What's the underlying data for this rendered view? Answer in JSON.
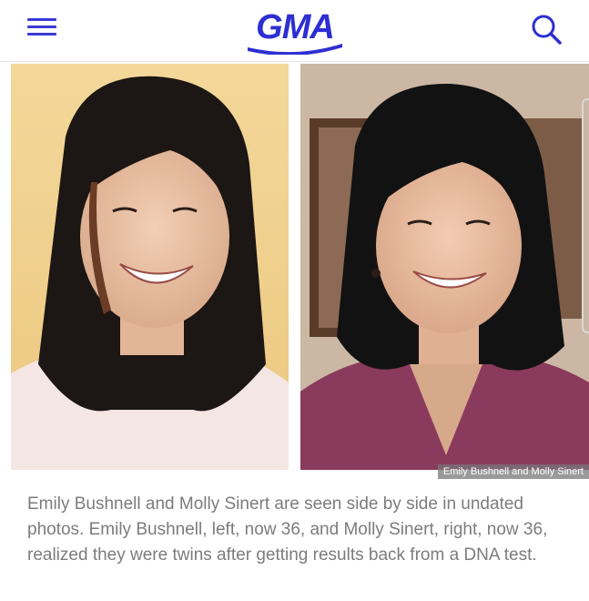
{
  "header": {
    "menu_icon": "hamburger-menu-icon",
    "logo_text": "GMA",
    "search_icon": "search-icon",
    "accent_color": "#2d2fd3"
  },
  "photos": {
    "left_subject": "Emily Bushnell",
    "right_subject": "Molly Sinert",
    "credit": "Emily Bushnell and Molly Sinert"
  },
  "caption": "Emily Bushnell and Molly Sinert are seen side by side in undated photos. Emily Bushnell, left, now 36, and Molly Sinert, right, now 36, realized they were twins after getting results back from a DNA test."
}
